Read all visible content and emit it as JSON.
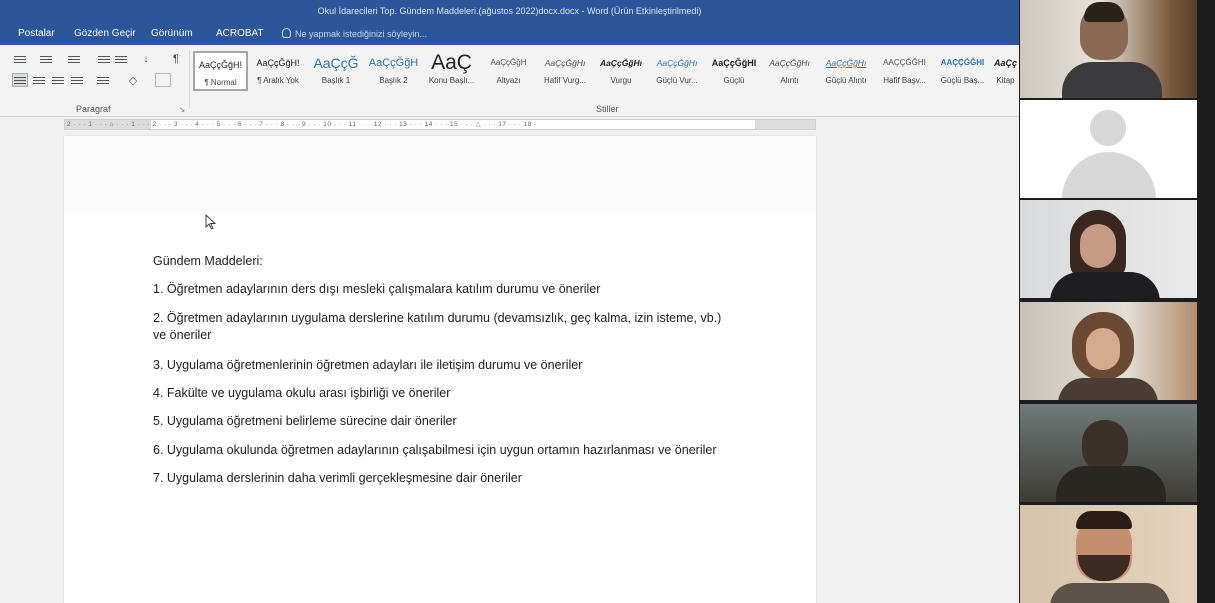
{
  "window": {
    "title": "Okul İdarecileri Top. Gündem Maddeleri.(ağustos 2022)docx.docx - Word (Ürün Etkinleştirilmedi)"
  },
  "menu": {
    "items": [
      "Postalar",
      "Gözden Geçir",
      "Görünüm",
      "ACROBAT"
    ],
    "tell_me": "Ne yapmak istediğinizi söyleyin..."
  },
  "ribbon": {
    "paragraph_label": "Paragraf",
    "styles_label": "Stiller",
    "styles": [
      {
        "preview": "AaÇçĞğH!",
        "name": "¶ Normal"
      },
      {
        "preview": "AaÇçĞğH!",
        "name": "¶ Aralık Yok"
      },
      {
        "preview": "AaÇçĞ",
        "name": "Başlık 1"
      },
      {
        "preview": "AaÇçĞğH",
        "name": "Başlık 2"
      },
      {
        "preview": "AaÇ",
        "name": "Konu Başlı..."
      },
      {
        "preview": "AaÇçĞğH",
        "name": "Altyazı"
      },
      {
        "preview": "AaÇçĞğHı",
        "name": "Hafif Vurg..."
      },
      {
        "preview": "AaÇçĞğHı",
        "name": "Vurgu"
      },
      {
        "preview": "AaÇçĞğHı",
        "name": "Güçlü Vur..."
      },
      {
        "preview": "AaÇçĞğHI",
        "name": "Güçlü"
      },
      {
        "preview": "AaÇçĞğHı",
        "name": "Alıntı"
      },
      {
        "preview": "AaÇçĞğHı",
        "name": "Güçlü Alıntı"
      },
      {
        "preview": "AAÇÇĞĞHI",
        "name": "Hafif Başv..."
      },
      {
        "preview": "AAÇÇĞĞHI",
        "name": "Güçlü Baş..."
      },
      {
        "preview": "AaÇç",
        "name": "Kitap"
      }
    ]
  },
  "ruler": {
    "text": "2 · · · 1 · · · ⌂ · · · 1 · · · 2 · · · 3 · · · 4 · · · 5 · · · 6 · · · 7 · · · 8 · · · 9 · · · 10 · · · 11 · · · 12 · · · 13 · · · 14 · · · 15 · · · △ · · · 17 · · · 18 ·"
  },
  "document": {
    "heading": "Gündem Maddeleri:",
    "items": [
      "1. Öğretmen adaylarının ders dışı mesleki çalışmalara katılım durumu ve öneriler",
      "2. Öğretmen adaylarının uygulama derslerine katılım durumu (devamsızlık, geç kalma, izin isteme, vb.) ve öneriler",
      "3. Uygulama öğretmenlerinin öğretmen adayları ile iletişim durumu ve öneriler",
      "4. Fakülte ve uygulama okulu arası işbirliği ve öneriler",
      "5. Uygulama öğretmeni belirleme sürecine dair öneriler",
      "6. Uygulama okulunda öğretmen adaylarının çalışabilmesi için uygun ortamın hazırlanması ve öneriler",
      "7. Uygulama derslerinin daha verimli gerçekleşmesine dair öneriler"
    ]
  },
  "colors": {
    "word_blue": "#2b579a",
    "strip_bg": "#1c1c1c"
  }
}
